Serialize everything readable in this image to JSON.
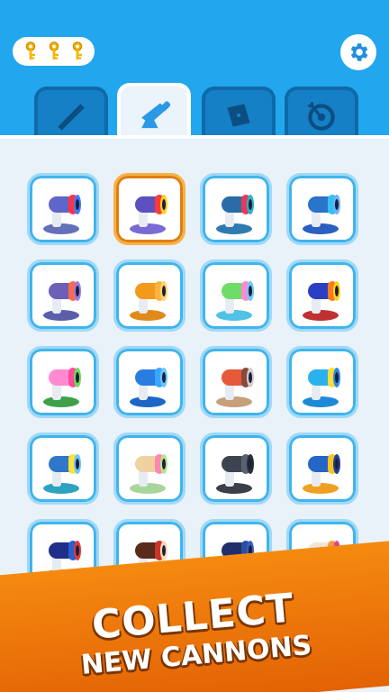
{
  "header": {
    "keys_count": 3,
    "settings_icon": "gear-icon",
    "accent": "#22a6ee"
  },
  "tabs": [
    {
      "name": "skins-tab",
      "icon": "bullet-icon",
      "active": false
    },
    {
      "name": "cannons-tab",
      "icon": "cannon-icon",
      "active": true
    },
    {
      "name": "maps-tab",
      "icon": "map-icon",
      "active": false
    },
    {
      "name": "targets-tab",
      "icon": "target-icon",
      "active": false
    }
  ],
  "cannons": [
    {
      "body": "#5f66c9",
      "barrel": "#ff3344",
      "rim": "#3d7bff",
      "base": "#6470b8",
      "selected": false
    },
    {
      "body": "#5d4fbf",
      "barrel": "#ff3a3a",
      "rim": "#ffd21e",
      "base": "#7a6ad4",
      "selected": true
    },
    {
      "body": "#2a6da6",
      "barrel": "#e53a57",
      "rim": "#2cb3c9",
      "base": "#2e7bb2",
      "selected": false
    },
    {
      "body": "#2a74c9",
      "barrel": "#33c1ee",
      "rim": "#6ab1ff",
      "base": "#2b5fc0",
      "selected": false
    },
    {
      "body": "#6b5fb6",
      "barrel": "#ff6a4a",
      "rim": "#9d7ae0",
      "base": "#5b5faa",
      "selected": false
    },
    {
      "body": "#f29a1a",
      "barrel": "#ffb43d",
      "rim": "#ffd36b",
      "base": "#e08a1a",
      "selected": false
    },
    {
      "body": "#6fdc6a",
      "barrel": "#ff8ad1",
      "rim": "#6ec7ff",
      "base": "#4fc2e6",
      "selected": false
    },
    {
      "body": "#2b3fc4",
      "barrel": "#ff7a1a",
      "rim": "#ffd21e",
      "base": "#c03030",
      "selected": false
    },
    {
      "body": "#ff8ad1",
      "barrel": "#ff4b9b",
      "rim": "#6edc5a",
      "base": "#3ea04a",
      "selected": false
    },
    {
      "body": "#2a7de0",
      "barrel": "#3ba6ff",
      "rim": "#6bc8ff",
      "base": "#1e67c6",
      "selected": false
    },
    {
      "body": "#e45a3a",
      "barrel": "#8a4a3a",
      "rim": "#d0d0d0",
      "base": "#c6a07a",
      "selected": false
    },
    {
      "body": "#2ab2ee",
      "barrel": "#ffdc3a",
      "rim": "#2a8ae6",
      "base": "#1e8ad6",
      "selected": false
    },
    {
      "body": "#2f78c9",
      "barrel": "#ffe23a",
      "rim": "#6bc4ff",
      "base": "#2ea3c0",
      "selected": false
    },
    {
      "body": "#f0d2a0",
      "barrel": "#ff87b0",
      "rim": "#b4e68a",
      "base": "#a8d69a",
      "selected": false
    },
    {
      "body": "#3d4450",
      "barrel": "#5a6170",
      "rim": "#2a2f38",
      "base": "#3a3f4a",
      "selected": false
    },
    {
      "body": "#2666c6",
      "barrel": "#ffc21e",
      "rim": "#1e3f9a",
      "base": "#f0a020",
      "selected": false
    },
    {
      "body": "#1f2f8a",
      "barrel": "#2a5fd0",
      "rim": "#e23a3a",
      "base": "#3a4a6a",
      "selected": false
    },
    {
      "body": "#5a2a1a",
      "barrel": "#c8352a",
      "rim": "#ffd9b0",
      "base": "#f2b38a",
      "selected": false
    },
    {
      "body": "#1f2f6a",
      "barrel": "#2a4fa0",
      "rim": "#3a5fc0",
      "base": "#2a3a5a",
      "selected": false
    },
    {
      "body": "#f0e6d8",
      "barrel": "#ff9a3a",
      "rim": "#d44b9b",
      "base": "#f2c8b0",
      "selected": false
    }
  ],
  "banner": {
    "line1": "COLLECT",
    "line2": "NEW CANNONS",
    "color": "#f07a0c"
  }
}
